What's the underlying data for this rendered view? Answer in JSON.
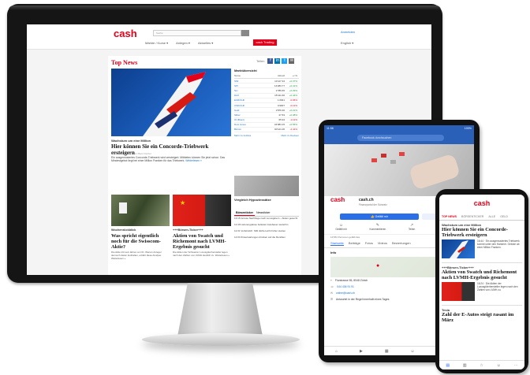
{
  "desktop": {
    "site_logo": "cash",
    "search_placeholder": "Suche",
    "login_link": "Anmelden",
    "nav": [
      "Märkte / Kurse ▾",
      "Anlegen ▾",
      "Aktuelles ▾"
    ],
    "trading_button": "cash Trading",
    "language": "English ▾",
    "top_news_title": "Top News",
    "share_label": "Teilen",
    "share_icons": [
      "f",
      "in",
      "t",
      "✉"
    ],
    "hero_kicker": "Wachstum um eine Million",
    "hero_headline": "Hier können Sie ein Concorde-Triebwerk ersteigern",
    "hero_meta": "21.05.2021 · 11:58 · Von Marc Fischer",
    "hero_lead": "Ein ausgemustertes Concorde-Triebwerk wird versteigert. Mitbieten können Sie jetzt schon. Das Mindestgebot liegt bei einer Million Franken für das Triebwerk.",
    "hero_more": "Weiterlesen »",
    "story2_kicker": "Wochenrückblick",
    "story2_headline": "Was spricht eigentlich noch für die Swisscom-Aktie?",
    "story2_text": "Die Aktie tritt seit Jahren an Ort. Warum Anleger dennoch daran festhalten, erklärt diese Analyse. Weiterlesen »",
    "story3_kicker": "+++Börsen-Ticker+++",
    "story3_headline": "Aktien von Swatch und Richemont nach LVMH-Ergebnis gesucht",
    "story3_text": "Die Aktien der Schweizer Luxusgüterhersteller legen nach den Zahlen von LVMH deutlich zu. Weiterlesen »",
    "market": {
      "title": "Marktübersicht",
      "headers": [
        "Name",
        "Aktuell",
        "+/-%"
      ],
      "rows": [
        {
          "name": "SMI",
          "value": "11'127.34",
          "change": "+0.37%"
        },
        {
          "name": "SPI",
          "value": "14'283.77",
          "change": "+0.41%"
        },
        {
          "name": "SLI",
          "value": "1'786.65",
          "change": "+0.29%"
        },
        {
          "name": "DAX",
          "value": "15'411.66",
          "change": "+0.44%"
        },
        {
          "name": "EUR/CHF",
          "value": "1.0941",
          "change": "-0.06%"
        },
        {
          "name": "USD/CHF",
          "value": "0.9007",
          "change": "-0.13%"
        },
        {
          "name": "Gold",
          "value": "1'876.30",
          "change": "+0.21%"
        },
        {
          "name": "Silber",
          "value": "27.53",
          "change": "+0.38%"
        },
        {
          "name": "Öl (Brent)",
          "value": "65.94",
          "change": "-1.12%"
        },
        {
          "name": "Dow Jones",
          "value": "34'084.15",
          "change": "+0.55%"
        },
        {
          "name": "Bitcoin",
          "value": "40'121.00",
          "change": "-2.41%"
        }
      ],
      "link_left": "Mehr zu Indizes",
      "link_right": "Mehr zu Devisen"
    },
    "side_teaser": "Vergleich Hypozinssätze",
    "news_tabs": [
      "Börsenticker",
      "Newsticker"
    ],
    "news_items": [
      "13:15 Grosse Nachfrage nach Luxusgütern – Aktien gesucht",
      "12:49 Lieferengpässe belasten Autobauer weiterhin",
      "12:31 Vorbörslich: SMI dürfte leicht höher starten",
      "12:03 Zinserwartungen drücken auf die Renditen"
    ]
  },
  "tablet": {
    "status_time": "11:58",
    "status_right": "100%",
    "search_placeholder": "Facebook durchsuchen",
    "page_logo": "cash",
    "page_name": "cash.ch",
    "page_sub": "Finanzportal der Schweiz",
    "follow_button": "👍 Gefällt mir",
    "message_button": "Nachricht",
    "actions": [
      {
        "icon": "☺",
        "label": "Gefällt mir"
      },
      {
        "icon": "✎",
        "label": "Kommentieren"
      },
      {
        "icon": "↗",
        "label": "Teilen"
      },
      {
        "icon": "☆",
        "label": "Empfehlung schreiben"
      }
    ],
    "likes_text": "12'054 Personen gefällt das",
    "tabs": [
      "Startseite",
      "Beiträge",
      "Fotos",
      "Videos",
      "Bewertungen"
    ],
    "info_heading": "Info",
    "address": "Flurstrasse 55, 8048 Zürich",
    "phone": "044 436 91 91",
    "email": "online@cash.ch",
    "reply_note": "Antwortet in der Regel innerhalb eines Tages"
  },
  "phone": {
    "logo": "cash",
    "tabs": [
      "TOP NEWS",
      "BÖRSENTICKER",
      "ALLE",
      "GELD"
    ],
    "kicker1": "Wachstum um eine Million",
    "headline1": "Hier können Sie ein Concorde-Triebwerk ersteigern",
    "text1": "16:44 · Ein ausgemustertes Triebwerk kommt unter den Hammer. Gebote ab einer Million Franken.",
    "kicker2": "+++Börsen-Ticker+++",
    "headline2": "Aktien von Swatch und Richemont nach LVMH-Ergebnis gesucht",
    "text2": "16:24 · Die Aktien der Luxusgüterhersteller legen nach den Zahlen von LVMH zu.",
    "kicker3": "Tesla",
    "headline3": "Zahl der E-Autos steigt rasant im März"
  }
}
